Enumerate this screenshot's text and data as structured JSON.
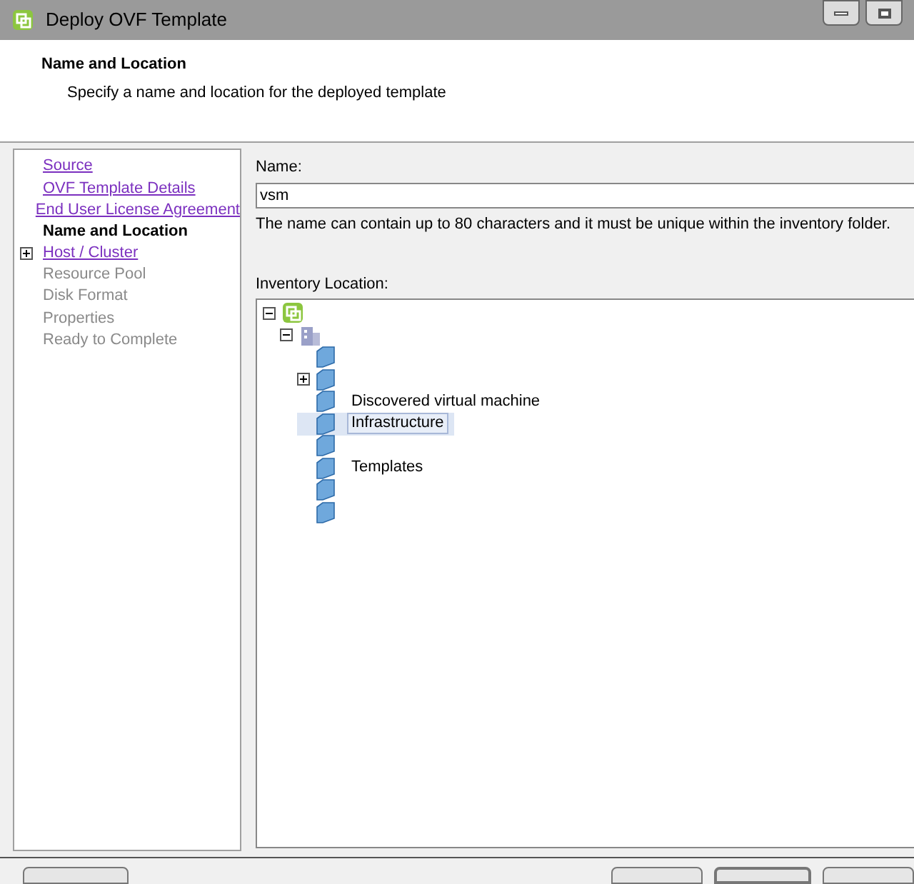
{
  "window": {
    "title": "Deploy OVF Template"
  },
  "header": {
    "title": "Name and Location",
    "subtitle": "Specify a name and location for the deployed template"
  },
  "steps": [
    {
      "label": "Source",
      "kind": "link",
      "expandable": false
    },
    {
      "label": "OVF Template Details",
      "kind": "link",
      "expandable": false
    },
    {
      "label": "End User License Agreement",
      "kind": "link",
      "expandable": false
    },
    {
      "label": "Name and Location",
      "kind": "current",
      "expandable": false
    },
    {
      "label": "Host / Cluster",
      "kind": "link",
      "expandable": true
    },
    {
      "label": "Resource Pool",
      "kind": "disabled",
      "expandable": false
    },
    {
      "label": "Disk Format",
      "kind": "disabled",
      "expandable": false
    },
    {
      "label": "Properties",
      "kind": "disabled",
      "expandable": false
    },
    {
      "label": "Ready to Complete",
      "kind": "disabled",
      "expandable": false
    }
  ],
  "name_field": {
    "label": "Name:",
    "value": "vsm",
    "hint": "The name can contain up to 80 characters and it must be unique within the inventory folder."
  },
  "inventory": {
    "label": "Inventory Location:",
    "tree": [
      {
        "kind": "vcenter",
        "expanded": true,
        "selected": false,
        "children": [
          {
            "kind": "datacenter",
            "expanded": true,
            "selected": false,
            "children": [
              {
                "kind": "folder",
                "selected": false
              },
              {
                "kind": "folder",
                "expanded": false,
                "selected": false
              },
              {
                "kind": "folder",
                "selected": false,
                "label": "Discovered virtual machine"
              },
              {
                "kind": "folder",
                "selected": true,
                "label": "Infrastructure"
              },
              {
                "kind": "folder",
                "selected": false
              },
              {
                "kind": "folder",
                "selected": false,
                "label": "Templates"
              },
              {
                "kind": "folder",
                "selected": false
              },
              {
                "kind": "folder",
                "selected": false
              }
            ]
          }
        ]
      }
    ]
  },
  "footer": {
    "buttons": [
      {
        "kind": "left"
      },
      {
        "kind": "right"
      },
      {
        "kind": "right_default"
      },
      {
        "kind": "right"
      }
    ]
  }
}
